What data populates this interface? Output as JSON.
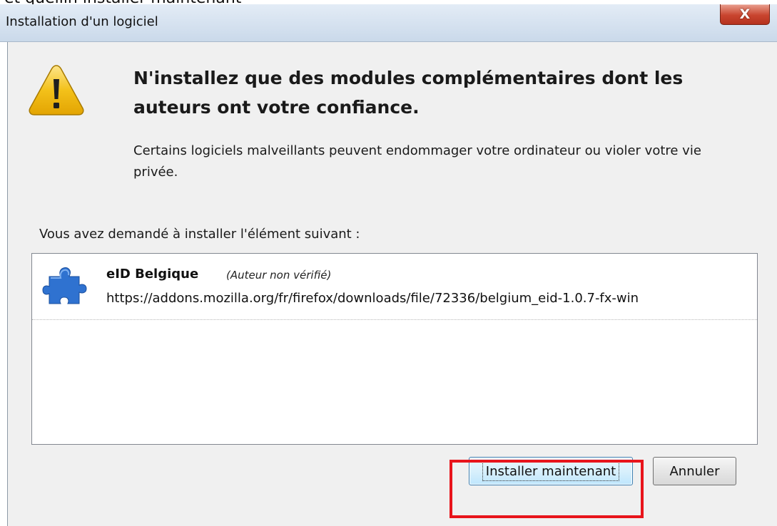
{
  "window": {
    "title": "Installation d'un logiciel",
    "background_fragment": "et quellin installer maintenant",
    "close_glyph": "X"
  },
  "warning": {
    "icon": "warning-triangle-icon",
    "headline": "N'installez que des modules complémentaires dont les auteurs ont votre confiance.",
    "description": "Certains logiciels malveillants peuvent endommager votre ordinateur ou violer votre vie privée."
  },
  "request": {
    "label": "Vous avez demandé à installer l'élément suivant :"
  },
  "items": [
    {
      "icon": "puzzle-piece-icon",
      "name": "eID Belgique",
      "author_note": "(Auteur non vérifié)",
      "url": "https://addons.mozilla.org/fr/firefox/downloads/file/72336/belgium_eid-1.0.7-fx-win"
    }
  ],
  "buttons": {
    "install": "Installer maintenant",
    "cancel": "Annuler"
  },
  "colors": {
    "highlight": "#e8141b",
    "close_button": "#c9452f",
    "puzzle": "#2f72d0",
    "warning": "#f3c11a"
  }
}
